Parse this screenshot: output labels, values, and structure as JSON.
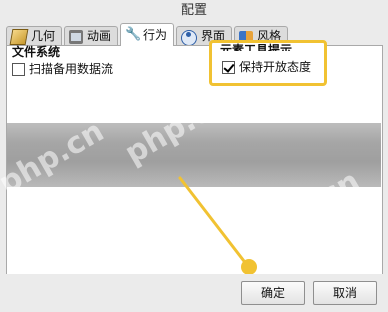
{
  "window": {
    "title": "配置"
  },
  "tabs": [
    {
      "label": "几何",
      "icon": "ruler-icon",
      "active": false
    },
    {
      "label": "动画",
      "icon": "film-icon",
      "active": false
    },
    {
      "label": "行为",
      "icon": "wrench-icon",
      "active": true
    },
    {
      "label": "界面",
      "icon": "eye-icon",
      "active": false
    },
    {
      "label": "风格",
      "icon": "brush-icon",
      "active": false
    }
  ],
  "file_system_group": {
    "heading": "文件系统",
    "options": [
      {
        "label": "扫描备用数据流",
        "checked": false
      }
    ]
  },
  "element_tooltip_group": {
    "heading": "元素工具提示",
    "options": [
      {
        "label": "保持开放态度",
        "checked": true
      }
    ]
  },
  "watermarks": [
    "php.cn",
    "php.cn",
    "php.cn"
  ],
  "buttons": {
    "ok_label": "确定",
    "cancel_label": "取消"
  },
  "colors": {
    "highlight": "#f1c232",
    "active_tab_bg": "#ffffff"
  }
}
